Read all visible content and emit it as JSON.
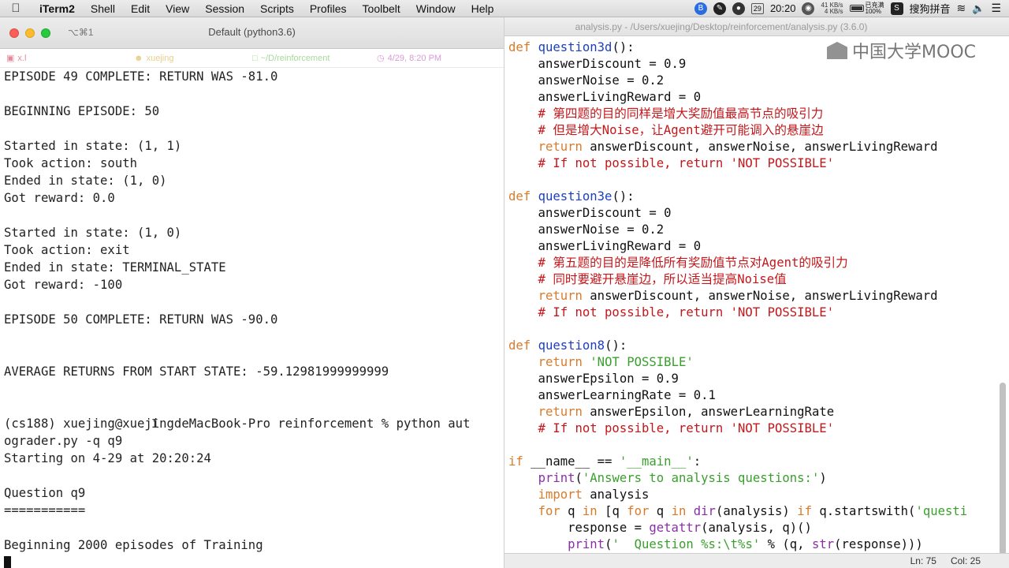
{
  "menubar": {
    "app": "iTerm2",
    "items": [
      "Shell",
      "Edit",
      "View",
      "Session",
      "Scripts",
      "Profiles",
      "Toolbelt",
      "Window",
      "Help"
    ],
    "date_badge": "29",
    "time": "20:20",
    "net_up": "41 KB/s",
    "net_down": "4 KB/s",
    "battery_label": "已充满",
    "battery_percent": "100%",
    "battery_level": 1.0,
    "ime": "搜狗拼音"
  },
  "terminal": {
    "shortcut": "⌥⌘1",
    "title": "Default (python3.6)",
    "status": {
      "host": "x.l",
      "user": "xuejing",
      "dir": "~/D/reinforcement",
      "datetime": "4/29, 8:20 PM"
    },
    "lines": [
      "EPISODE 49 COMPLETE: RETURN WAS -81.0",
      "",
      "BEGINNING EPISODE: 50",
      "",
      "Started in state: (1, 1)",
      "Took action: south",
      "Ended in state: (1, 0)",
      "Got reward: 0.0",
      "",
      "Started in state: (1, 0)",
      "Took action: exit",
      "Ended in state: TERMINAL_STATE",
      "Got reward: -100",
      "",
      "EPISODE 50 COMPLETE: RETURN WAS -90.0",
      "",
      "",
      "AVERAGE RETURNS FROM START STATE: -59.12981999999999",
      "",
      "",
      "(cs188) xuejing@xuejingdeMacBook-Pro reinforcement % python aut",
      "ograder.py -q q9",
      "Starting on 4-29 at 20:20:24",
      "",
      "Question q9",
      "===========",
      "",
      "Beginning 2000 episodes of Training"
    ]
  },
  "editor": {
    "title": "analysis.py - /Users/xuejing/Desktop/reinforcement/analysis.py (3.6.0)",
    "watermark": "中国大学MOOC",
    "code": [
      [
        {
          "t": "def ",
          "c": "kw"
        },
        {
          "t": "question3d",
          "c": "fn"
        },
        {
          "t": "():",
          "c": "nm"
        }
      ],
      [
        {
          "t": "    answerDiscount = 0.9",
          "c": "nm"
        }
      ],
      [
        {
          "t": "    answerNoise = 0.2",
          "c": "nm"
        }
      ],
      [
        {
          "t": "    answerLivingReward = 0",
          "c": "nm"
        }
      ],
      [
        {
          "t": "    # 第四题的目的同样是增大奖励值最高节点的吸引力",
          "c": "cm"
        }
      ],
      [
        {
          "t": "    # 但是增大Noise，让Agent避开可能调入的悬崖边",
          "c": "cm"
        }
      ],
      [
        {
          "t": "    ",
          "c": "nm"
        },
        {
          "t": "return",
          "c": "kw"
        },
        {
          "t": " answerDiscount, answerNoise, answerLivingReward",
          "c": "nm"
        }
      ],
      [
        {
          "t": "    # If not possible, return 'NOT POSSIBLE'",
          "c": "cm"
        }
      ],
      [
        {
          "t": "",
          "c": "nm"
        }
      ],
      [
        {
          "t": "def ",
          "c": "kw"
        },
        {
          "t": "question3e",
          "c": "fn"
        },
        {
          "t": "():",
          "c": "nm"
        }
      ],
      [
        {
          "t": "    answerDiscount = 0",
          "c": "nm"
        }
      ],
      [
        {
          "t": "    answerNoise = 0.2",
          "c": "nm"
        }
      ],
      [
        {
          "t": "    answerLivingReward = 0",
          "c": "nm"
        }
      ],
      [
        {
          "t": "    # 第五题的目的是降低所有奖励值节点对Agent的吸引力",
          "c": "cm"
        }
      ],
      [
        {
          "t": "    # 同时要避开悬崖边，所以适当提高Noise值",
          "c": "cm"
        }
      ],
      [
        {
          "t": "    ",
          "c": "nm"
        },
        {
          "t": "return",
          "c": "kw"
        },
        {
          "t": " answerDiscount, answerNoise, answerLivingReward",
          "c": "nm"
        }
      ],
      [
        {
          "t": "    # If not possible, return 'NOT POSSIBLE'",
          "c": "cm"
        }
      ],
      [
        {
          "t": "",
          "c": "nm"
        }
      ],
      [
        {
          "t": "def ",
          "c": "kw"
        },
        {
          "t": "question8",
          "c": "fn"
        },
        {
          "t": "():",
          "c": "nm"
        }
      ],
      [
        {
          "t": "    ",
          "c": "nm"
        },
        {
          "t": "return",
          "c": "kw"
        },
        {
          "t": " ",
          "c": "nm"
        },
        {
          "t": "'NOT POSSIBLE'",
          "c": "st"
        }
      ],
      [
        {
          "t": "    answerEpsilon = 0.9",
          "c": "nm"
        }
      ],
      [
        {
          "t": "    answerLearningRate = 0.1",
          "c": "nm"
        }
      ],
      [
        {
          "t": "    ",
          "c": "nm"
        },
        {
          "t": "return",
          "c": "kw"
        },
        {
          "t": " answerEpsilon, answerLearningRate",
          "c": "nm"
        }
      ],
      [
        {
          "t": "    # If not possible, return 'NOT POSSIBLE'",
          "c": "cm"
        }
      ],
      [
        {
          "t": "",
          "c": "nm"
        }
      ],
      [
        {
          "t": "if",
          "c": "kw"
        },
        {
          "t": " __name__ == ",
          "c": "nm"
        },
        {
          "t": "'__main__'",
          "c": "st"
        },
        {
          "t": ":",
          "c": "nm"
        }
      ],
      [
        {
          "t": "    ",
          "c": "nm"
        },
        {
          "t": "print",
          "c": "bi"
        },
        {
          "t": "(",
          "c": "nm"
        },
        {
          "t": "'Answers to analysis questions:'",
          "c": "st"
        },
        {
          "t": ")",
          "c": "nm"
        }
      ],
      [
        {
          "t": "    ",
          "c": "nm"
        },
        {
          "t": "import",
          "c": "kw"
        },
        {
          "t": " analysis",
          "c": "nm"
        }
      ],
      [
        {
          "t": "    ",
          "c": "nm"
        },
        {
          "t": "for",
          "c": "kw"
        },
        {
          "t": " q ",
          "c": "nm"
        },
        {
          "t": "in",
          "c": "kw"
        },
        {
          "t": " [q ",
          "c": "nm"
        },
        {
          "t": "for",
          "c": "kw"
        },
        {
          "t": " q ",
          "c": "nm"
        },
        {
          "t": "in",
          "c": "kw"
        },
        {
          "t": " ",
          "c": "nm"
        },
        {
          "t": "dir",
          "c": "bi"
        },
        {
          "t": "(analysis) ",
          "c": "nm"
        },
        {
          "t": "if",
          "c": "kw"
        },
        {
          "t": " q.startswith(",
          "c": "nm"
        },
        {
          "t": "'questi",
          "c": "st"
        }
      ],
      [
        {
          "t": "        response = ",
          "c": "nm"
        },
        {
          "t": "getattr",
          "c": "bi"
        },
        {
          "t": "(analysis, q)()",
          "c": "nm"
        }
      ],
      [
        {
          "t": "        ",
          "c": "nm"
        },
        {
          "t": "print",
          "c": "bi"
        },
        {
          "t": "(",
          "c": "nm"
        },
        {
          "t": "'  Question %s:\\t%s'",
          "c": "st"
        },
        {
          "t": " % (q, ",
          "c": "nm"
        },
        {
          "t": "str",
          "c": "bi"
        },
        {
          "t": "(response)))",
          "c": "nm"
        }
      ]
    ],
    "status": {
      "ln": "Ln: 75",
      "col": "Col: 25"
    }
  }
}
